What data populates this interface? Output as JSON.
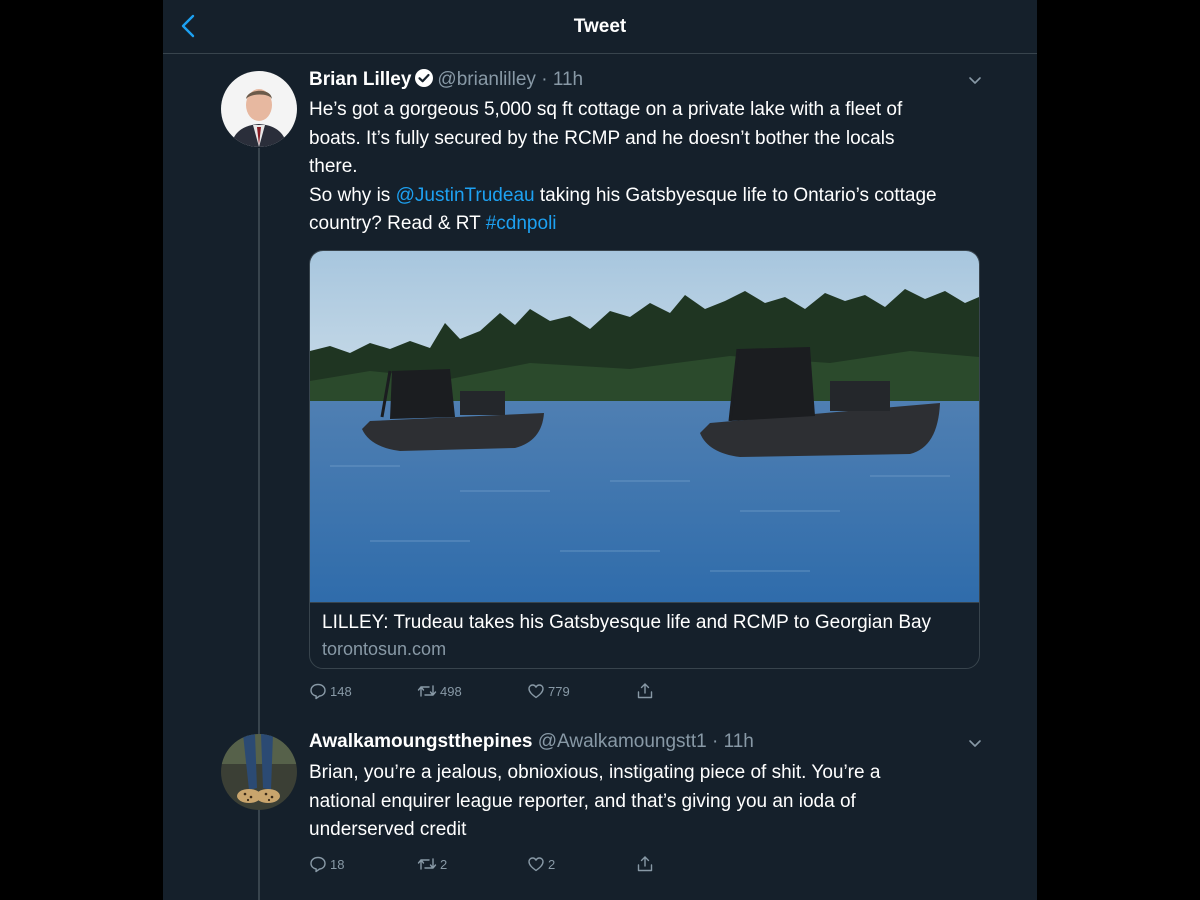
{
  "header": {
    "title": "Tweet"
  },
  "tweet": {
    "name": "Brian Lilley",
    "handle": "@brianlilley",
    "time": "11h",
    "lines": [
      [
        "He’s got a gorgeous 5,000 sq ft cottage on a private lake with a fleet of"
      ],
      [
        "boats. It’s fully secured by the RCMP and he doesn’t bother the locals"
      ],
      [
        "there."
      ],
      [
        "So why is ",
        "@JustinTrudeau",
        " taking his Gatsbyesque life to Ontario’s cottage"
      ],
      [
        "country? Read & RT ",
        "#cdnpoli"
      ]
    ],
    "text_line1": "He’s got a gorgeous 5,000 sq ft cottage on a private lake with a fleet of",
    "text_line2": "boats. It’s fully secured by the RCMP and he doesn’t bother the locals",
    "text_line3": "there.",
    "text_line4a": "So why is ",
    "mention": "@JustinTrudeau",
    "text_line4b": " taking his Gatsbyesque life to Ontario’s cottage",
    "text_line5a": "country? Read & RT ",
    "hashtag": "#cdnpoli",
    "card": {
      "title": "LILLEY: Trudeau takes his Gatsbyesque life and RCMP to Georgian Bay",
      "domain": "torontosun.com"
    },
    "replies": "148",
    "retweets": "498",
    "likes": "779"
  },
  "reply": {
    "name": "Awalkamoungstthepines",
    "handle": "@Awalkamoungstt1",
    "time": "11h",
    "text_line1": "Brian, you’re a jealous, obnioxious, instigating piece of shit.  You’re a",
    "text_line2": "national enquirer league reporter, and that’s giving you an ioda of",
    "text_line3": "underserved credit",
    "replies": "18",
    "retweets": "2",
    "likes": "2"
  },
  "icons": [
    "back-arrow-icon",
    "verified-badge-icon",
    "chevron-down-icon",
    "reply-icon",
    "retweet-icon",
    "like-icon",
    "share-icon"
  ],
  "colors": {
    "background": "#15202b",
    "accent": "#1da1f2",
    "secondary_text": "#8899a6",
    "border": "#38444d"
  }
}
